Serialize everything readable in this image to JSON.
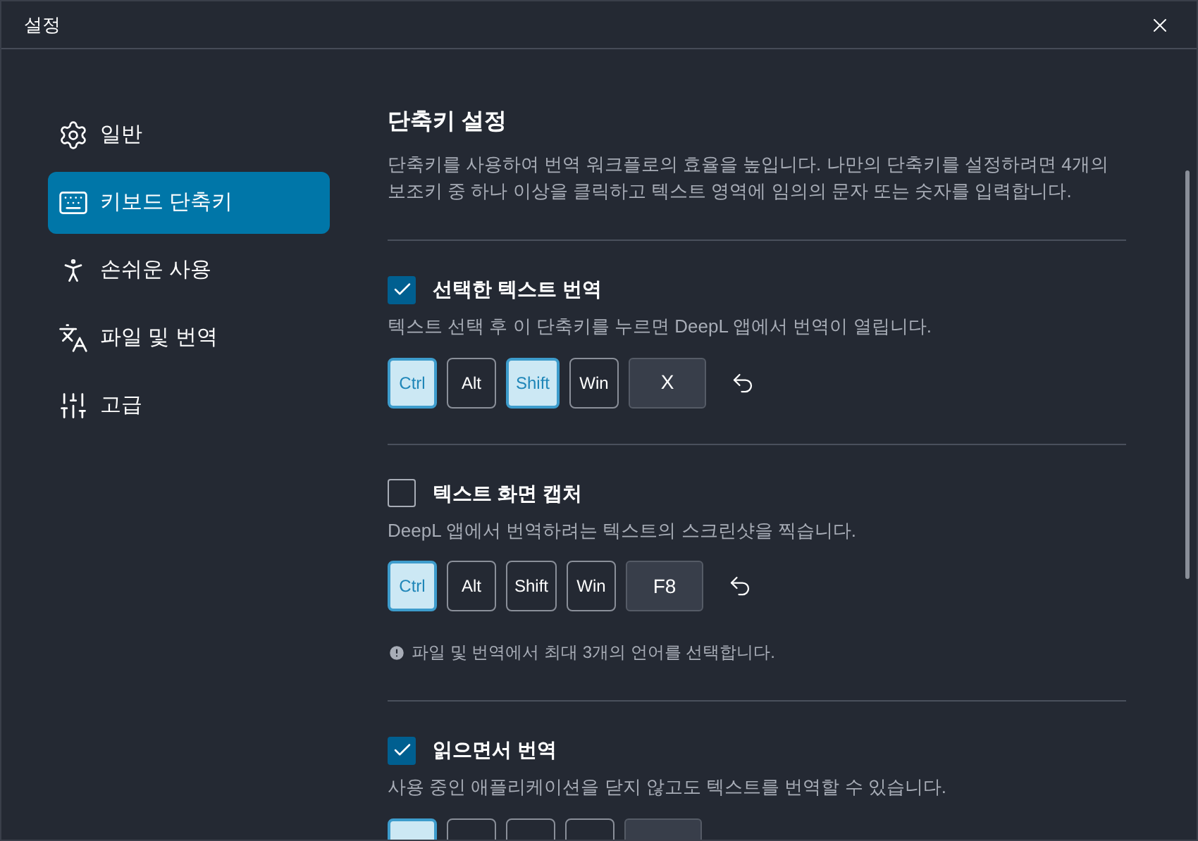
{
  "window": {
    "title": "설정"
  },
  "sidebar": {
    "items": [
      {
        "label": "일반",
        "selected": false
      },
      {
        "label": "키보드 단축키",
        "selected": true
      },
      {
        "label": "손쉬운 사용",
        "selected": false
      },
      {
        "label": "파일 및 번역",
        "selected": false
      },
      {
        "label": "고급",
        "selected": false
      }
    ]
  },
  "content": {
    "title": "단축키 설정",
    "description": "단축키를 사용하여 번역 워크플로의 효율을 높입니다. 나만의 단축키를 설정하려면 4개의 보조키 중 하나 이상을 클릭하고 텍스트 영역에 임의의 문자 또는 숫자를 입력합니다.",
    "sections": [
      {
        "label": "선택한 텍스트 번역",
        "checked": true,
        "description": "텍스트 선택 후 이 단축키를 누르면 DeepL 앱에서 번역이 열립니다.",
        "keys": [
          {
            "label": "Ctrl",
            "selected": true
          },
          {
            "label": "Alt",
            "selected": false
          },
          {
            "label": "Shift",
            "selected": true
          },
          {
            "label": "Win",
            "selected": false
          }
        ],
        "key": "X"
      },
      {
        "label": "텍스트 화면 캡처",
        "checked": false,
        "description": "DeepL 앱에서 번역하려는 텍스트의 스크린샷을 찍습니다.",
        "keys": [
          {
            "label": "Ctrl",
            "selected": true
          },
          {
            "label": "Alt",
            "selected": false
          },
          {
            "label": "Shift",
            "selected": false
          },
          {
            "label": "Win",
            "selected": false
          }
        ],
        "key": "F8",
        "note": "파일 및 번역에서 최대 3개의 언어를 선택합니다."
      },
      {
        "label": "읽으면서 번역",
        "checked": true,
        "description": "사용 중인 애플리케이션을 닫지 않고도 텍스트를 번역할 수 있습니다.",
        "keys": [
          {
            "selected": true
          },
          {
            "selected": false
          },
          {
            "selected": false
          },
          {
            "selected": false
          }
        ]
      }
    ]
  }
}
